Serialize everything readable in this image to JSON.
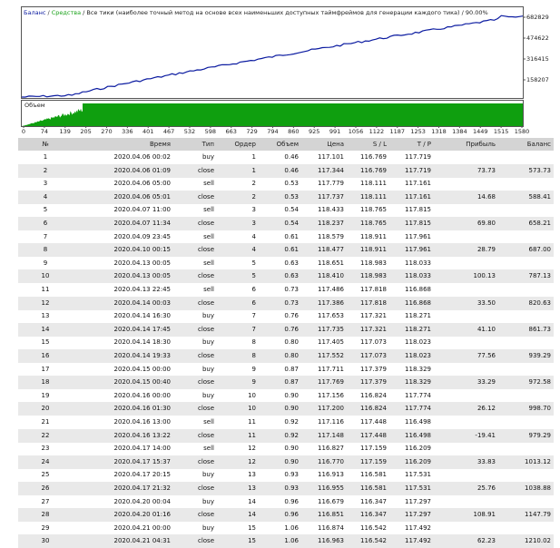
{
  "chart": {
    "title_balance": "Баланс",
    "title_sep1": " / ",
    "title_equity": "Средства",
    "title_rest": " / Все тики (наиболее точный метод на основе всех наименьших доступных таймфреймов для генерации каждого тика) / 90.00%",
    "volume_label": "Объем",
    "y_labels": [
      "682829",
      "474622",
      "316415",
      "158207"
    ],
    "x_labels": [
      "0",
      "74",
      "139",
      "205",
      "270",
      "336",
      "401",
      "467",
      "532",
      "598",
      "663",
      "729",
      "794",
      "860",
      "925",
      "991",
      "1056",
      "1122",
      "1187",
      "1253",
      "1318",
      "1384",
      "1449",
      "1515",
      "1580"
    ],
    "colors": {
      "balance": "#0a1aa0",
      "equity": "#1aa11a",
      "volume": "#0f9f0f"
    }
  },
  "table": {
    "headers": [
      "№",
      "Время",
      "Тип",
      "Ордер",
      "Объем",
      "Цена",
      "S / L",
      "T / P",
      "Прибыль",
      "Баланс"
    ],
    "rows": [
      [
        "1",
        "2020.04.06 00:02",
        "buy",
        "1",
        "0.46",
        "117.101",
        "116.769",
        "117.719",
        "",
        ""
      ],
      [
        "2",
        "2020.04.06 01:09",
        "close",
        "1",
        "0.46",
        "117.344",
        "116.769",
        "117.719",
        "73.73",
        "573.73"
      ],
      [
        "3",
        "2020.04.06 05:00",
        "sell",
        "2",
        "0.53",
        "117.779",
        "118.111",
        "117.161",
        "",
        ""
      ],
      [
        "4",
        "2020.04.06 05:01",
        "close",
        "2",
        "0.53",
        "117.737",
        "118.111",
        "117.161",
        "14.68",
        "588.41"
      ],
      [
        "5",
        "2020.04.07 11:00",
        "sell",
        "3",
        "0.54",
        "118.433",
        "118.765",
        "117.815",
        "",
        ""
      ],
      [
        "6",
        "2020.04.07 11:34",
        "close",
        "3",
        "0.54",
        "118.237",
        "118.765",
        "117.815",
        "69.80",
        "658.21"
      ],
      [
        "7",
        "2020.04.09 23:45",
        "sell",
        "4",
        "0.61",
        "118.579",
        "118.911",
        "117.961",
        "",
        ""
      ],
      [
        "8",
        "2020.04.10 00:15",
        "close",
        "4",
        "0.61",
        "118.477",
        "118.911",
        "117.961",
        "28.79",
        "687.00"
      ],
      [
        "9",
        "2020.04.13 00:05",
        "sell",
        "5",
        "0.63",
        "118.651",
        "118.983",
        "118.033",
        "",
        ""
      ],
      [
        "10",
        "2020.04.13 00:05",
        "close",
        "5",
        "0.63",
        "118.410",
        "118.983",
        "118.033",
        "100.13",
        "787.13"
      ],
      [
        "11",
        "2020.04.13 22:45",
        "sell",
        "6",
        "0.73",
        "117.486",
        "117.818",
        "116.868",
        "",
        ""
      ],
      [
        "12",
        "2020.04.14 00:03",
        "close",
        "6",
        "0.73",
        "117.386",
        "117.818",
        "116.868",
        "33.50",
        "820.63"
      ],
      [
        "13",
        "2020.04.14 16:30",
        "buy",
        "7",
        "0.76",
        "117.653",
        "117.321",
        "118.271",
        "",
        ""
      ],
      [
        "14",
        "2020.04.14 17:45",
        "close",
        "7",
        "0.76",
        "117.735",
        "117.321",
        "118.271",
        "41.10",
        "861.73"
      ],
      [
        "15",
        "2020.04.14 18:30",
        "buy",
        "8",
        "0.80",
        "117.405",
        "117.073",
        "118.023",
        "",
        ""
      ],
      [
        "16",
        "2020.04.14 19:33",
        "close",
        "8",
        "0.80",
        "117.552",
        "117.073",
        "118.023",
        "77.56",
        "939.29"
      ],
      [
        "17",
        "2020.04.15 00:00",
        "buy",
        "9",
        "0.87",
        "117.711",
        "117.379",
        "118.329",
        "",
        ""
      ],
      [
        "18",
        "2020.04.15 00:40",
        "close",
        "9",
        "0.87",
        "117.769",
        "117.379",
        "118.329",
        "33.29",
        "972.58"
      ],
      [
        "19",
        "2020.04.16 00:00",
        "buy",
        "10",
        "0.90",
        "117.156",
        "116.824",
        "117.774",
        "",
        ""
      ],
      [
        "20",
        "2020.04.16 01:30",
        "close",
        "10",
        "0.90",
        "117.200",
        "116.824",
        "117.774",
        "26.12",
        "998.70"
      ],
      [
        "21",
        "2020.04.16 13:00",
        "sell",
        "11",
        "0.92",
        "117.116",
        "117.448",
        "116.498",
        "",
        ""
      ],
      [
        "22",
        "2020.04.16 13:22",
        "close",
        "11",
        "0.92",
        "117.148",
        "117.448",
        "116.498",
        "-19.41",
        "979.29"
      ],
      [
        "23",
        "2020.04.17 14:00",
        "sell",
        "12",
        "0.90",
        "116.827",
        "117.159",
        "116.209",
        "",
        ""
      ],
      [
        "24",
        "2020.04.17 15:37",
        "close",
        "12",
        "0.90",
        "116.770",
        "117.159",
        "116.209",
        "33.83",
        "1013.12"
      ],
      [
        "25",
        "2020.04.17 20:15",
        "buy",
        "13",
        "0.93",
        "116.913",
        "116.581",
        "117.531",
        "",
        ""
      ],
      [
        "26",
        "2020.04.17 21:32",
        "close",
        "13",
        "0.93",
        "116.955",
        "116.581",
        "117.531",
        "25.76",
        "1038.88"
      ],
      [
        "27",
        "2020.04.20 00:04",
        "buy",
        "14",
        "0.96",
        "116.679",
        "116.347",
        "117.297",
        "",
        ""
      ],
      [
        "28",
        "2020.04.20 01:16",
        "close",
        "14",
        "0.96",
        "116.851",
        "116.347",
        "117.297",
        "108.91",
        "1147.79"
      ],
      [
        "29",
        "2020.04.21 00:00",
        "buy",
        "15",
        "1.06",
        "116.874",
        "116.542",
        "117.492",
        "",
        ""
      ],
      [
        "30",
        "2020.04.21 04:31",
        "close",
        "15",
        "1.06",
        "116.963",
        "116.542",
        "117.492",
        "62.23",
        "1210.02"
      ]
    ]
  }
}
